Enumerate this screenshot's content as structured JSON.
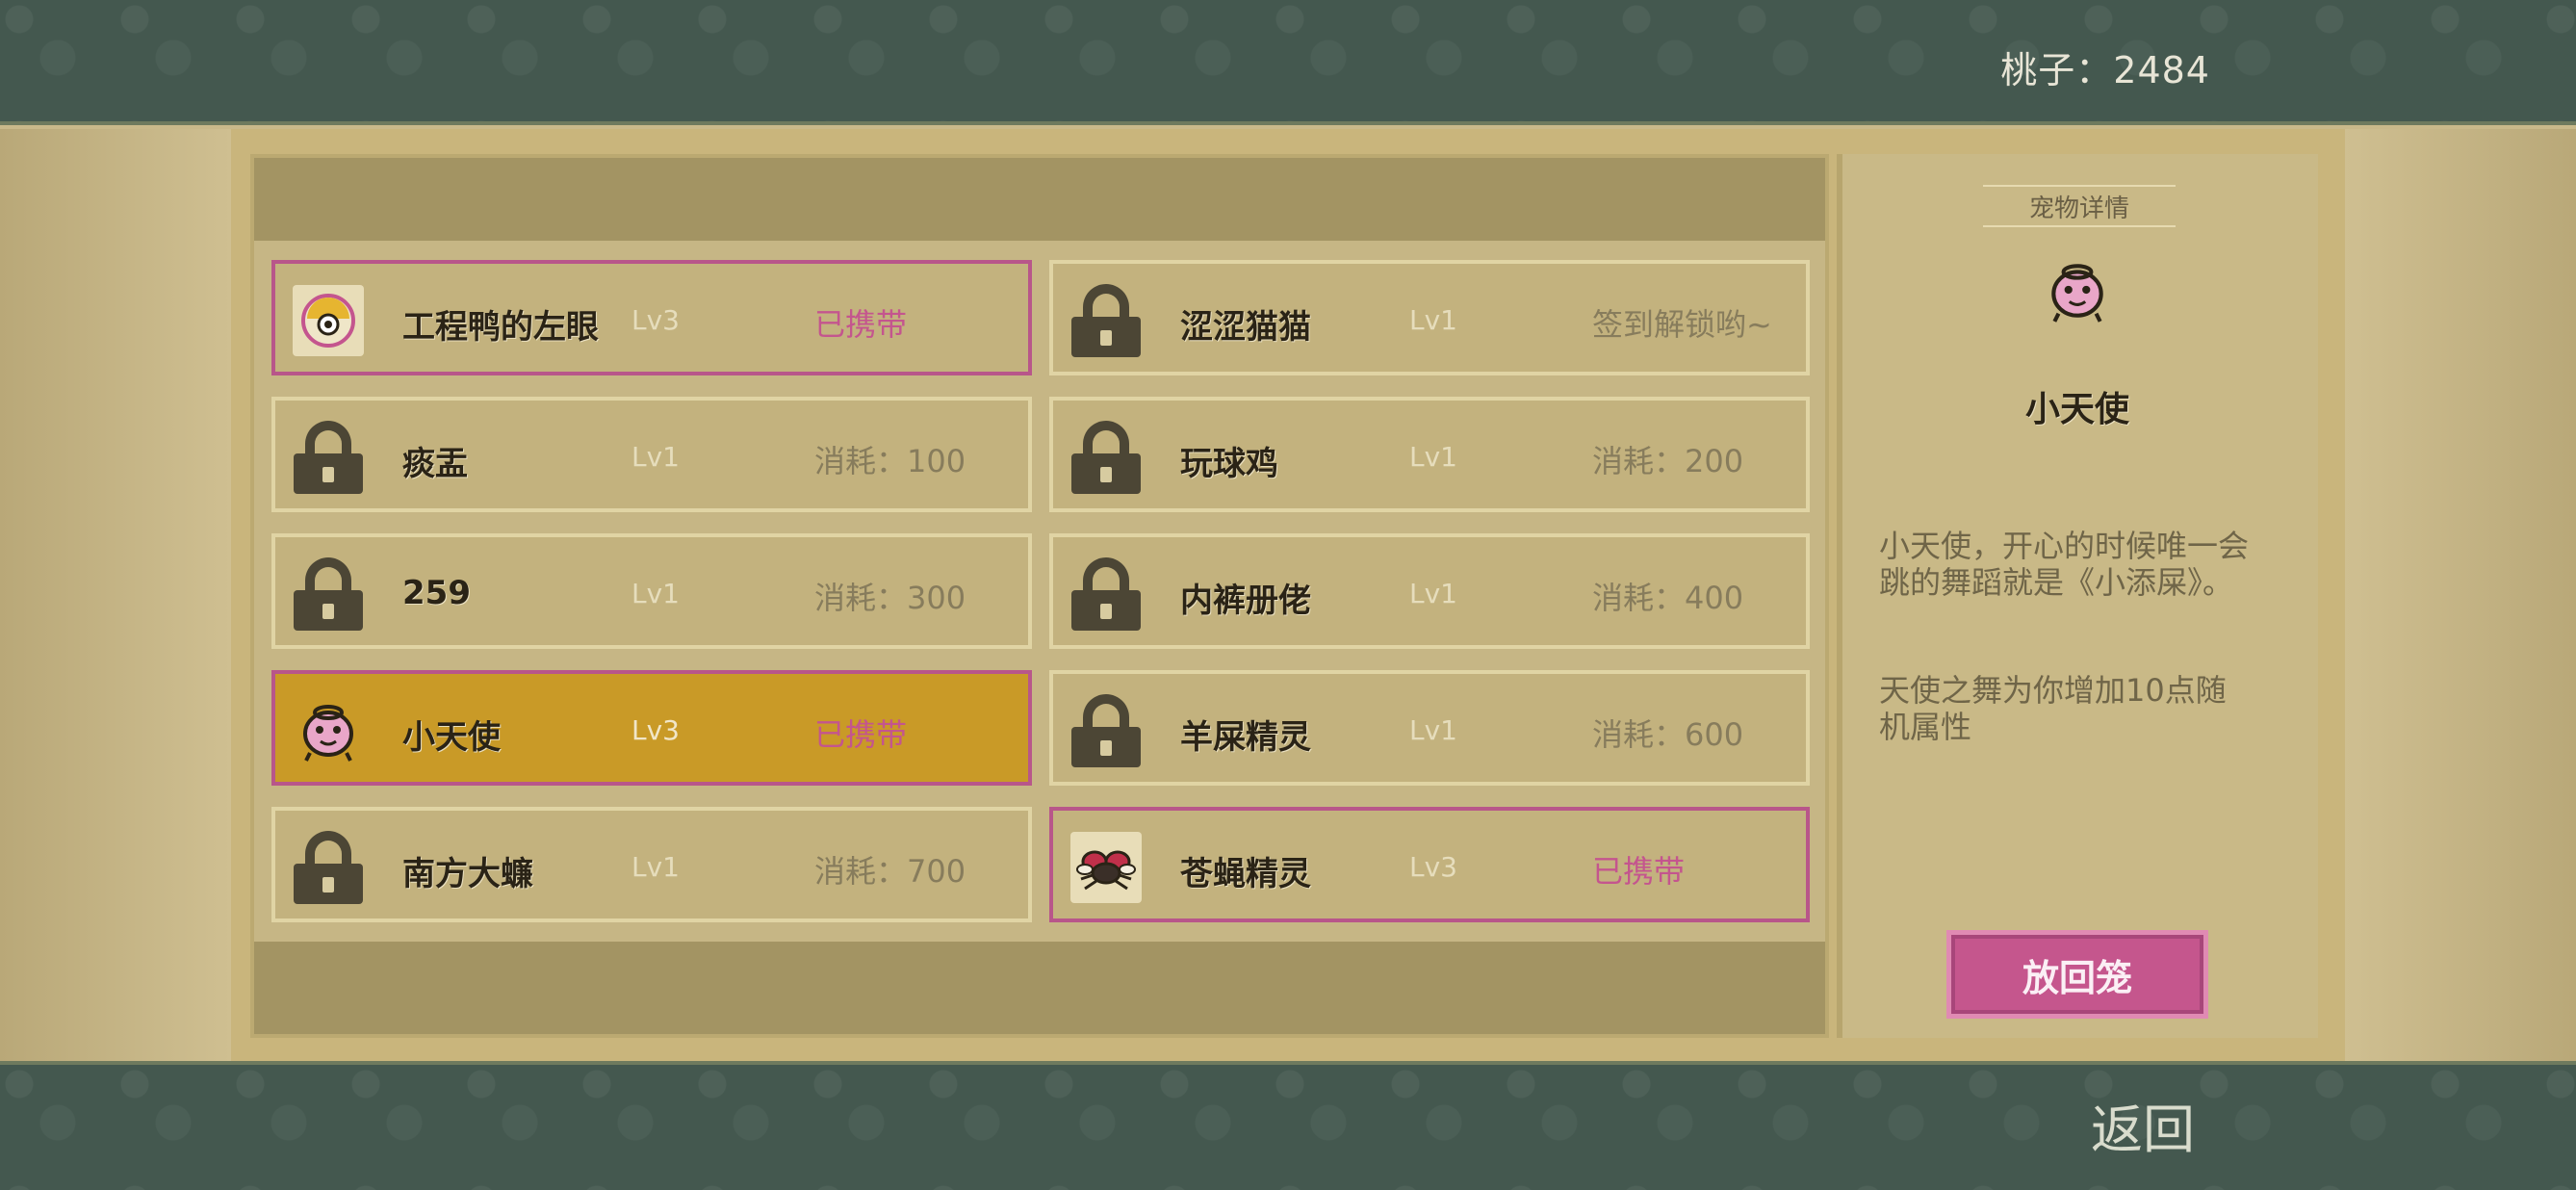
{
  "header": {
    "currency_label": "桃子：",
    "currency_value": "2484"
  },
  "pets": [
    {
      "name": "工程鸭的左眼",
      "level": "Lv3",
      "status": "已携带",
      "state": "carried",
      "icon": "duck-eye-icon"
    },
    {
      "name": "涩涩猫猫",
      "level": "Lv1",
      "status": "签到解锁哟~",
      "state": "locked",
      "icon": "lock-icon"
    },
    {
      "name": "痰盂",
      "level": "Lv1",
      "status": "消耗：100",
      "state": "locked",
      "icon": "lock-icon"
    },
    {
      "name": "玩球鸡",
      "level": "Lv1",
      "status": "消耗：200",
      "state": "locked",
      "icon": "lock-icon"
    },
    {
      "name": "259",
      "level": "Lv1",
      "status": "消耗：300",
      "state": "locked",
      "icon": "lock-icon"
    },
    {
      "name": "内裤册佬",
      "level": "Lv1",
      "status": "消耗：400",
      "state": "locked",
      "icon": "lock-icon"
    },
    {
      "name": "小天使",
      "level": "Lv3",
      "status": "已携带",
      "state": "selected",
      "icon": "angel-icon"
    },
    {
      "name": "羊屎精灵",
      "level": "Lv1",
      "status": "消耗：600",
      "state": "locked",
      "icon": "lock-icon"
    },
    {
      "name": "南方大蠊",
      "level": "Lv1",
      "status": "消耗：700",
      "state": "locked",
      "icon": "lock-icon"
    },
    {
      "name": "苍蝇精灵",
      "level": "Lv3",
      "status": "已携带",
      "state": "carried",
      "icon": "fly-icon"
    }
  ],
  "detail": {
    "title": "宠物详情",
    "name": "小天使",
    "description": "小天使，开心的时候唯一会跳的舞蹈就是《小添屎》。",
    "effect": "天使之舞为你增加10点随机属性",
    "button_label": "放回笼"
  },
  "footer": {
    "back_label": "返回"
  },
  "colors": {
    "carried_border": "#b8568a",
    "selected_bg": "#c99a27",
    "accent_pink": "#c5568d"
  }
}
